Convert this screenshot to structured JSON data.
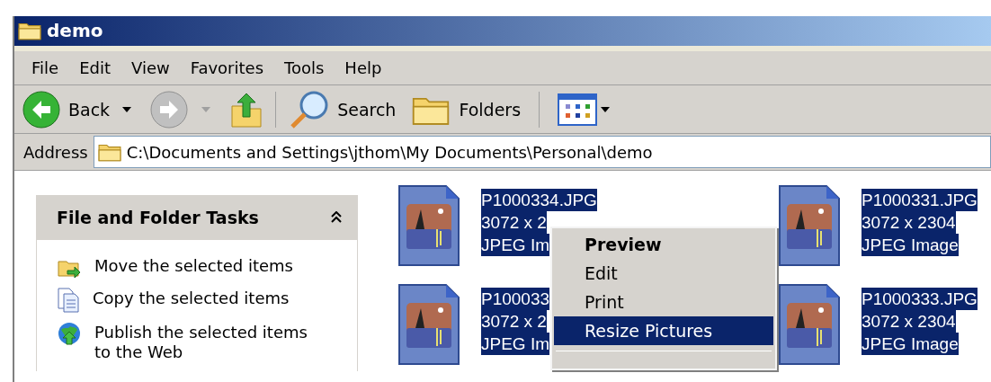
{
  "window": {
    "title": "demo"
  },
  "menu_bar": [
    "File",
    "Edit",
    "View",
    "Favorites",
    "Tools",
    "Help"
  ],
  "toolbar": {
    "back": "Back",
    "search": "Search",
    "folders": "Folders"
  },
  "address": {
    "label": "Address",
    "value": "C:\\Documents and Settings\\jthom\\My Documents\\Personal\\demo"
  },
  "task_panel": {
    "title": "File and Folder Tasks",
    "expanded": true,
    "items": [
      {
        "kind": "move",
        "label": "Move the selected items"
      },
      {
        "kind": "copy",
        "label": "Copy the selected items"
      },
      {
        "kind": "publish",
        "label": "Publish the selected items to the Web"
      }
    ]
  },
  "files": [
    {
      "name": "P1000334.JPG",
      "dimensions": "3072 x 2",
      "type": "JPEG Im",
      "selected": true
    },
    {
      "name": "P1000331.JPG",
      "dimensions": "3072 x 2304",
      "type": "JPEG Image",
      "selected": true
    },
    {
      "name": "P100033",
      "dimensions": "3072 x 2",
      "type": "JPEG Im",
      "selected": true
    },
    {
      "name": "P1000333.JPG",
      "dimensions": "3072 x 2304",
      "type": "JPEG Image",
      "selected": true
    }
  ],
  "context_menu": {
    "items": [
      {
        "label": "Preview",
        "default": true,
        "selected": false
      },
      {
        "label": "Edit",
        "default": false,
        "selected": false
      },
      {
        "label": "Print",
        "default": false,
        "selected": false
      },
      {
        "label": "Resize Pictures",
        "default": false,
        "selected": true
      }
    ]
  }
}
